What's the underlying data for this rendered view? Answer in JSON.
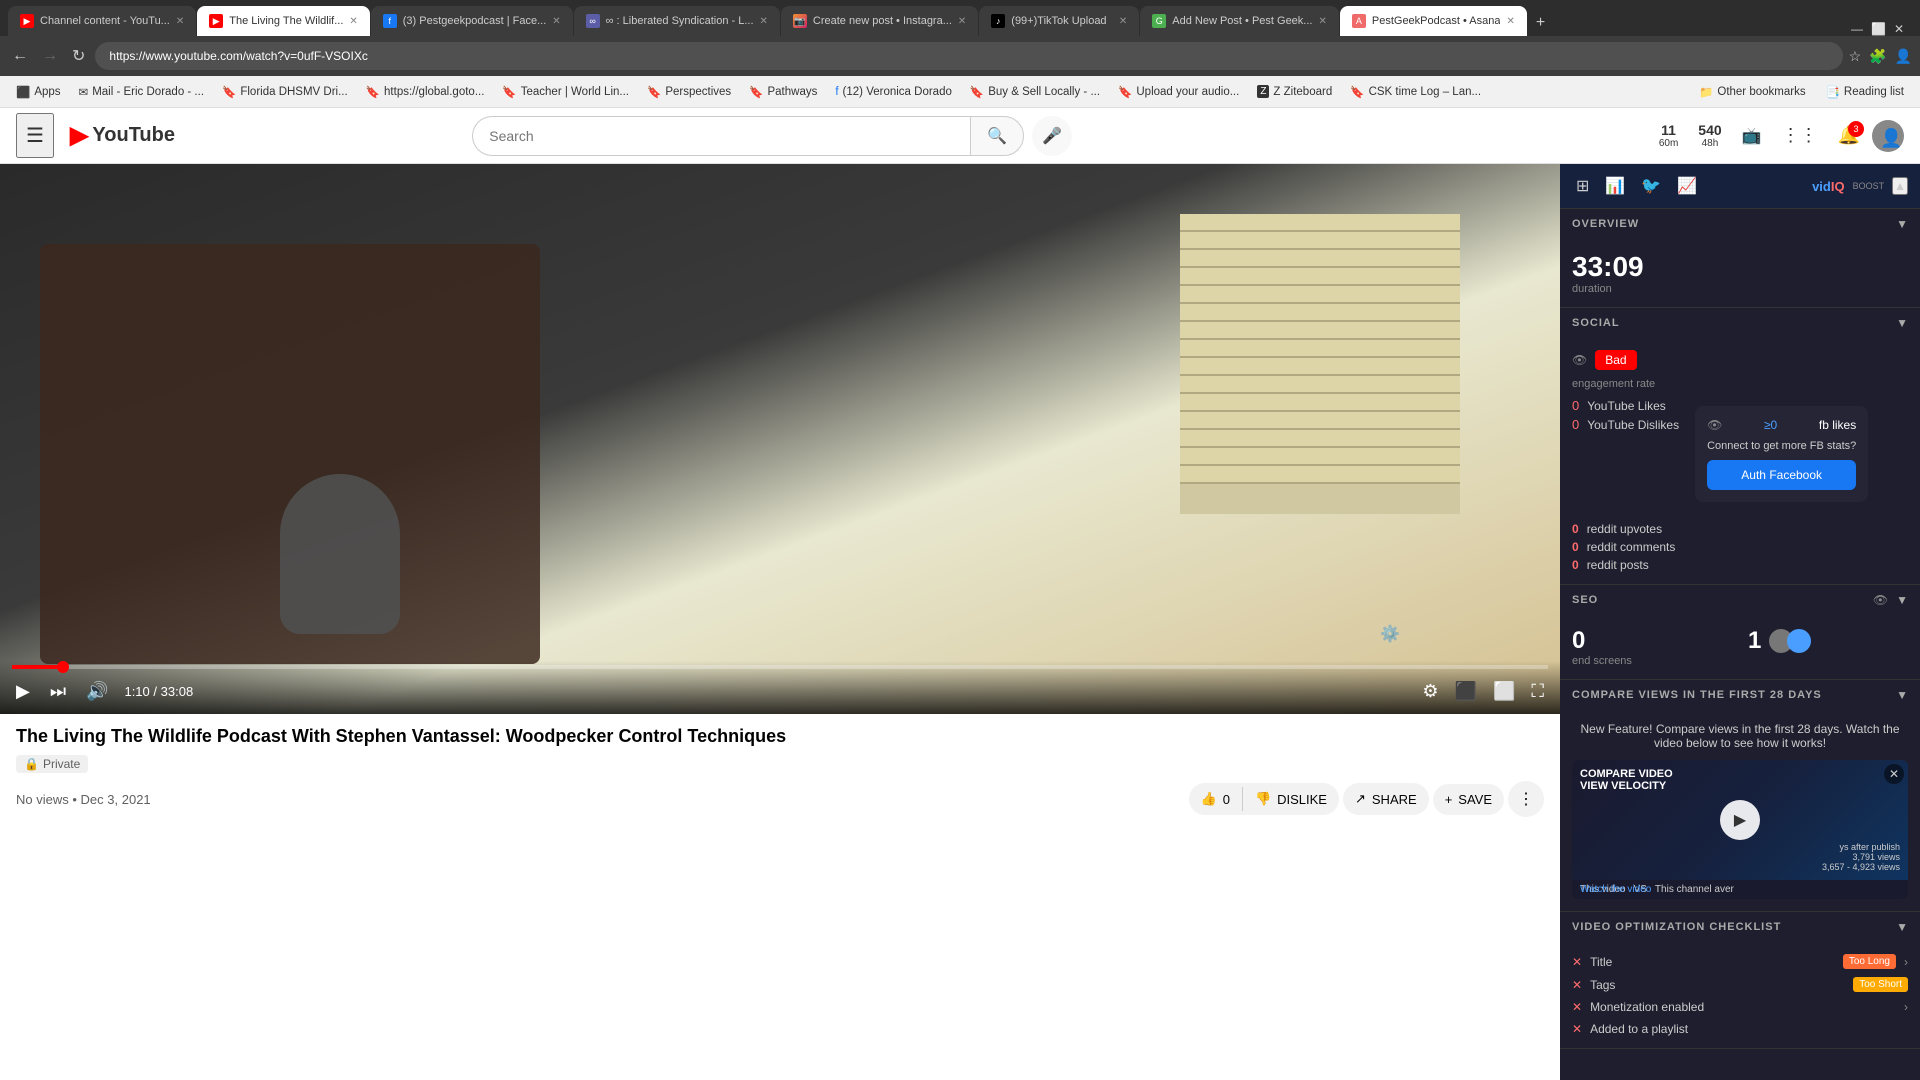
{
  "browser": {
    "tabs": [
      {
        "id": "tab1",
        "favicon_color": "#ff0000",
        "favicon_letter": "▶",
        "title": "Channel content - YouTu...",
        "active": false
      },
      {
        "id": "tab2",
        "favicon_color": "#ff0000",
        "favicon_letter": "▶",
        "title": "The Living The Wildlif...",
        "active": true
      },
      {
        "id": "tab3",
        "favicon_color": "#1877f2",
        "favicon_letter": "f",
        "title": "(3) Pestgeekpodcast | Face...",
        "active": false
      },
      {
        "id": "tab4",
        "favicon_color": "#5b5ea6",
        "favicon_letter": "L",
        "title": "∞ : Liberated Syndication - L...",
        "active": false
      },
      {
        "id": "tab5",
        "favicon_color": "#e1306c",
        "favicon_letter": "📷",
        "title": "Create new post • Instagra...",
        "active": false
      },
      {
        "id": "tab6",
        "favicon_color": "#000",
        "favicon_letter": "♪",
        "title": "(99+)TikTok Upload",
        "active": false
      },
      {
        "id": "tab7",
        "favicon_color": "#4caf50",
        "favicon_letter": "G",
        "title": "Add New Post • Pest Geek...",
        "active": false
      },
      {
        "id": "tab8",
        "favicon_color": "#f06a6a",
        "favicon_letter": "A",
        "title": "PestGeekPodcast • Asana",
        "active": true
      }
    ],
    "url": "https://www.youtube.com/watch?v=0ufF-VSOIXc",
    "back_disabled": false,
    "forward_disabled": true
  },
  "bookmarks": [
    {
      "label": "Apps",
      "favicon": "⬛"
    },
    {
      "label": "Mail - Eric Dorado - ...",
      "favicon": "✉"
    },
    {
      "label": "Florida DHSMV Dri...",
      "favicon": "🔖"
    },
    {
      "label": "https://global.goto...",
      "favicon": "🔖"
    },
    {
      "label": "Teacher | World Lin...",
      "favicon": "🔖"
    },
    {
      "label": "Perspectives",
      "favicon": "🔖"
    },
    {
      "label": "Pathways",
      "favicon": "🔖"
    },
    {
      "label": "(12) Veronica Dorado",
      "favicon": "f"
    },
    {
      "label": "Buy & Sell Locally - ...",
      "favicon": "🔖"
    },
    {
      "label": "Upload your audio...",
      "favicon": "🔖"
    },
    {
      "label": "Z Ziteboard",
      "favicon": "Z"
    },
    {
      "label": "CSK time Log – Lan...",
      "favicon": "🔖"
    },
    {
      "label": "Other bookmarks",
      "favicon": "📁"
    },
    {
      "label": "Reading list",
      "favicon": "📑"
    }
  ],
  "youtube": {
    "search_placeholder": "Search",
    "search_value": "",
    "logo_text": "YouTube",
    "header_counts": {
      "left": "11",
      "left_sub": "60m",
      "right": "540",
      "right_sub": "48h"
    }
  },
  "video": {
    "title": "The Living The Wildlife Podcast With Stephen Vantassel: Woodpecker Control Techniques",
    "private_label": "Private",
    "views": "No views",
    "date": "Dec 3, 2021",
    "time_current": "1:10",
    "time_total": "33:08",
    "progress_percent": 3.3,
    "like_count": "0",
    "like_label": "LIKE",
    "dislike_label": "DISLIKE",
    "share_label": "SHARE",
    "save_label": "SAVE"
  },
  "vidiq": {
    "logo": "vidIQ",
    "overview": {
      "title": "OVERVIEW",
      "duration": "33:09",
      "duration_label": "duration"
    },
    "social": {
      "title": "SOCIAL",
      "engagement_badge": "Bad",
      "engagement_label": "engagement rate",
      "yt_likes": "0",
      "yt_likes_label": "YouTube Likes",
      "yt_dislikes": "0",
      "yt_dislikes_label": "YouTube Dislikes",
      "fb_likes": "≥0",
      "fb_likes_label": "fb likes",
      "reddit_upvotes": "0",
      "reddit_upvotes_label": "reddit upvotes",
      "reddit_comments": "0",
      "reddit_comments_label": "reddit comments",
      "reddit_posts": "0",
      "reddit_posts_label": "reddit posts",
      "fb_connect_text": "Connect to get more FB stats?",
      "fb_auth_label": "Auth Facebook"
    },
    "seo": {
      "title": "SEO",
      "end_screens": "0",
      "end_screens_label": "end screens",
      "cards_count": "1"
    },
    "compare": {
      "title": "COMPARE VIEWS IN THE FIRST 28 DAYS",
      "new_feature_text": "New Feature! Compare views in the first 28 days. Watch the video below to see how it works!",
      "video_label1": "This video",
      "video_label2": "VS",
      "channel_label": "This channel aver",
      "watch_label": "Watch the video",
      "stats_line1": "ys after publish",
      "stats_line2": "3,791 views",
      "stats_line3": "3,657 - 4,923 views"
    },
    "checklist": {
      "title": "VIDEO OPTIMIZATION CHECKLIST",
      "items": [
        {
          "label": "Title",
          "status": "Too Long",
          "status_type": "too-long",
          "has_arrow": true
        },
        {
          "label": "Tags",
          "status": "Too Short",
          "status_type": "too-short",
          "has_arrow": false
        },
        {
          "label": "Monetization enabled",
          "status": "",
          "has_arrow": true
        },
        {
          "label": "Added to a playlist",
          "status": "",
          "has_arrow": false
        }
      ]
    }
  }
}
